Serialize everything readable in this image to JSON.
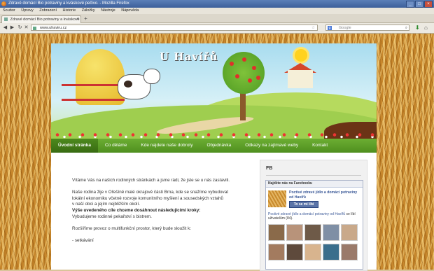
{
  "browser": {
    "window_title": "Zdravé domácí Bio potraviny a kváskové pečivo. - Mozilla Firefox",
    "menu": [
      "Soubor",
      "Úpravy",
      "Zobrazení",
      "Historie",
      "Záložky",
      "Nástroje",
      "Nápověda"
    ],
    "tab_title": "Zdravé domácí Bio potraviny a kváskové pe...",
    "url": "www.uhaviru.cz",
    "search_placeholder": "Google"
  },
  "site": {
    "title": "U Havířů",
    "nav": [
      "Úvodní stránka",
      "Co děláme",
      "Kde najdete naše dobroty",
      "Objednávka",
      "Odkazy na zajímavé weby",
      "Kontakt"
    ],
    "content": {
      "p1": "Vítáme Vás na našich rodinných stránkách a jsme rádi, že jste se u nás zastavili.",
      "p2_line1": "Naše rodina žije v Ořešíně malé okrajové části Brna, kde se snažíme vybudovat",
      "p2_line2": "lokální ekonomiku včetně rozvoje komunitního myšlení a sousedských vztahů",
      "p2_line3": "v naší obci a jejím nejbližším okolí.",
      "goal_bold": "Výše uvedeného cíle chceme dosáhnout následujícími kroky:",
      "goal_line": "Vybudujeme rodinné pekařství s bistrem.",
      "p3": "Rozšíříme provoz o multifunkční prostor, který bude sloužit k:",
      "p4": "- setkávání"
    },
    "sidebar": {
      "title": "FB",
      "fb_header": "Najděte nás na Facebooku",
      "page_name": "Poctivé zdravé jídlo a domácí potraviny od Havířů",
      "like_label": "To se mi líbí",
      "count_link": "Poctivé zdravé jídlo a domácí potraviny od Havířů",
      "count_text": "se líbí uživatelům (84)."
    }
  },
  "colors": {
    "nav_green": "#5a9a25",
    "title_bar": "#4a6da8",
    "fb_blue": "#3b5998"
  }
}
